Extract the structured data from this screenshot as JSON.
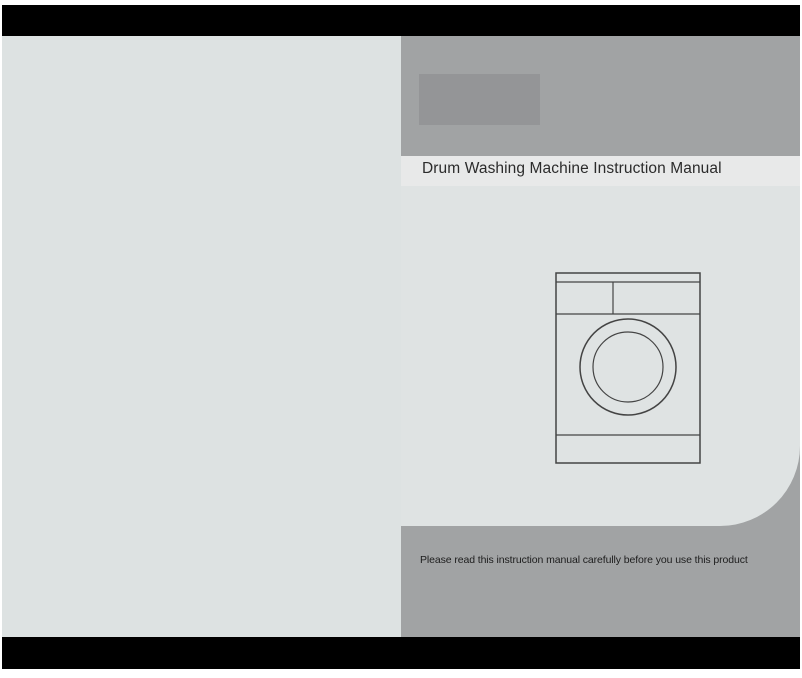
{
  "manual": {
    "title": "Drum Washing Machine Instruction Manual",
    "footer_note": "Please read this instruction manual carefully before you use this product"
  },
  "illustration": {
    "icon": "washing-machine-icon"
  },
  "colors": {
    "bars": "#000000",
    "left_page": "#dde2e2",
    "right_page": "#a1a3a4",
    "panel": "#dfe3e3",
    "line_art": "#444444"
  }
}
